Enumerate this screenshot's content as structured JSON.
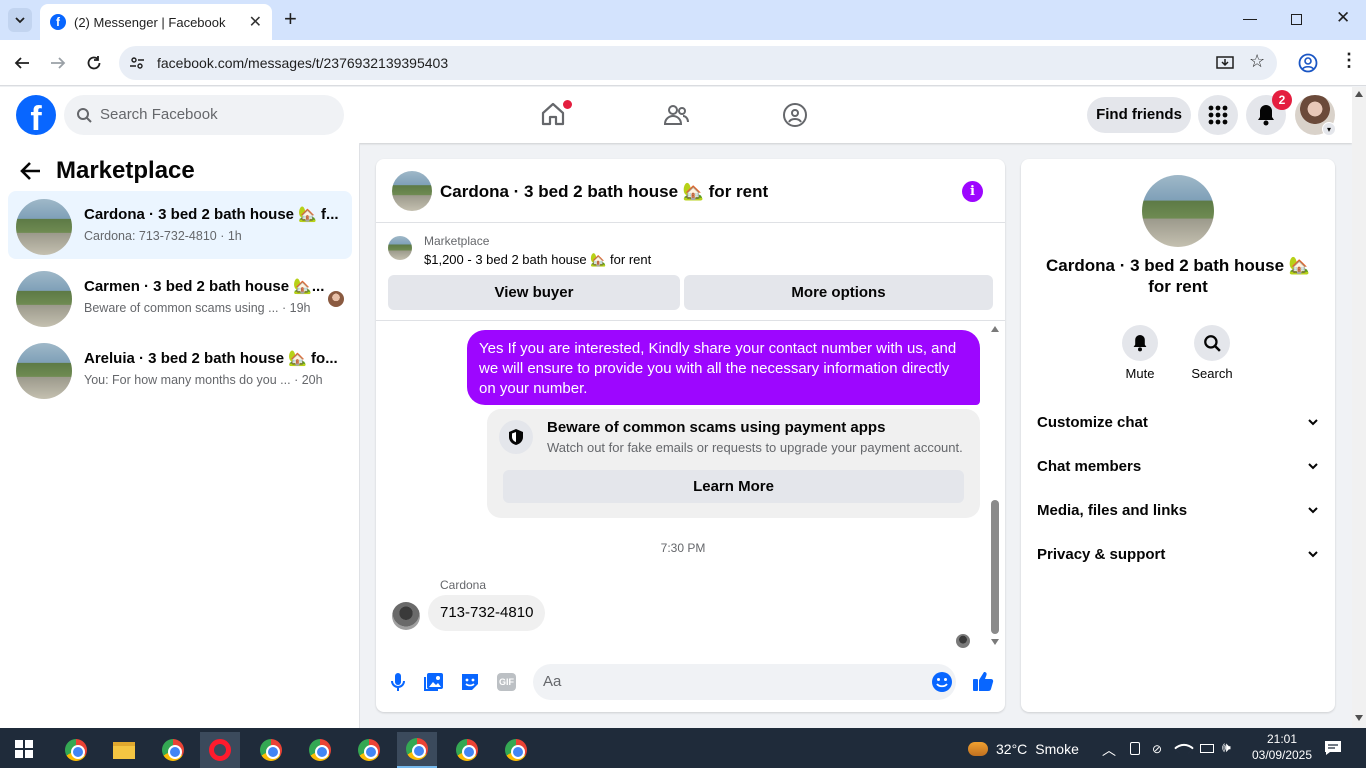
{
  "browser": {
    "tab_title": "(2) Messenger | Facebook",
    "url": "facebook.com/messages/t/2376932139395403"
  },
  "fb": {
    "search_placeholder": "Search Facebook",
    "find_friends": "Find friends",
    "notif_count": "2",
    "accent": "#0866ff",
    "purple": "#9d06ff"
  },
  "left": {
    "title": "Marketplace",
    "conversations": [
      {
        "title": "Cardona · 3 bed 2 bath house 🏡 f...",
        "snippet": "Cardona: 713-732-4810 · 1h"
      },
      {
        "title": "Carmen · 3 bed 2 bath house 🏡...",
        "snippet": "Beware of common scams using ... · 19h"
      },
      {
        "title": "Areluia · 3 bed 2 bath house 🏡 fo...",
        "snippet": "You: For how many months do you ... · 20h"
      }
    ]
  },
  "chat": {
    "title": "Cardona · 3 bed 2 bath house 🏡 for rent",
    "listing_label": "Marketplace",
    "listing_text": "$1,200 - 3 bed 2 bath house 🏡 for rent",
    "view_buyer": "View buyer",
    "more_options": "More options",
    "sent_message": "Yes If you are interested, Kindly share your contact number with us, and we will ensure to provide you with all the necessary information directly on your number.",
    "scam_title": "Beware of common scams using payment apps",
    "scam_text": "Watch out for fake emails or requests to upgrade your payment account.",
    "learn_more": "Learn More",
    "timestamp": "7:30 PM",
    "sender": "Cardona",
    "received_message": "713-732-4810",
    "composer_placeholder": "Aa"
  },
  "details": {
    "name": "Cardona · 3 bed 2 bath house 🏡 for rent",
    "mute": "Mute",
    "search": "Search",
    "sections": [
      "Customize chat",
      "Chat members",
      "Media, files and links",
      "Privacy & support"
    ]
  },
  "taskbar": {
    "temperature": "32°C",
    "weather": "Smoke",
    "time": "21:01",
    "date": "03/09/2025"
  }
}
